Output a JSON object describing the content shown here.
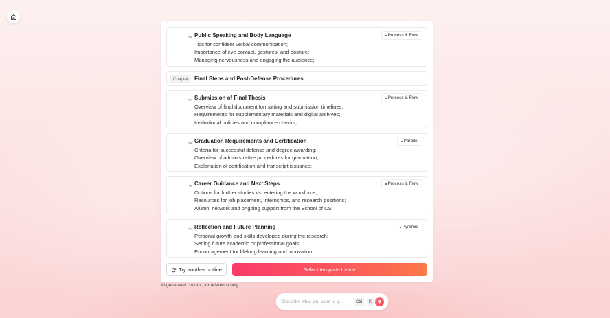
{
  "outline": {
    "cards_top": [
      {
        "title": "Public Speaking and Body Language",
        "badge": "Process & Flow",
        "lines": [
          "Tips for confident verbal communication;",
          "Importance of eye contact, gestures, and posture;",
          "Managing nervousness and engaging the audience;"
        ]
      }
    ],
    "chapter": {
      "tag": "Chapter",
      "title": "Final Steps and Post-Defense Procedures"
    },
    "cards": [
      {
        "title": "Submission of Final Thesis",
        "badge": "Process & Flow",
        "lines": [
          "Overview of final document formatting and submission timelines;",
          "Requirements for supplementary materials and digital archives;",
          "Institutional policies and compliance checks;"
        ]
      },
      {
        "title": "Graduation Requirements and Certification",
        "badge": "Parallel",
        "lines": [
          "Criteria for successful defense and degree awarding;",
          "Overview of administrative procedures for graduation;",
          "Explanation of certification and transcript issuance;"
        ]
      },
      {
        "title": "Career Guidance and Next Steps",
        "badge": "Process & Flow",
        "lines": [
          "Options for further studies vs. entering the workforce;",
          "Resources for job placement, internships, and research positions;",
          "Alumni network and ongoing support from the School of CS;"
        ]
      },
      {
        "title": "Reflection and Future Planning",
        "badge": "Pyramid",
        "lines": [
          "Personal growth and skills developed during the research;",
          "Setting future academic or professional goals;",
          "Encouragement for lifelong learning and innovation;"
        ]
      }
    ]
  },
  "actions": {
    "try_another": "Try another outline",
    "select_theme": "Select template theme"
  },
  "disclaimer": "AI-generated content, for reference only.",
  "ask_bar": {
    "placeholder": "Describe what you want to g...",
    "kbd_ctrl": "Ctrl",
    "kbd_k": "K"
  },
  "icons": {
    "home": "home-icon",
    "chevron": "chevron-down-icon",
    "refresh": "refresh-icon",
    "send": "send-icon"
  },
  "colors": {
    "accent_start": "#fb3a6a",
    "accent_end": "#fc7a48"
  }
}
